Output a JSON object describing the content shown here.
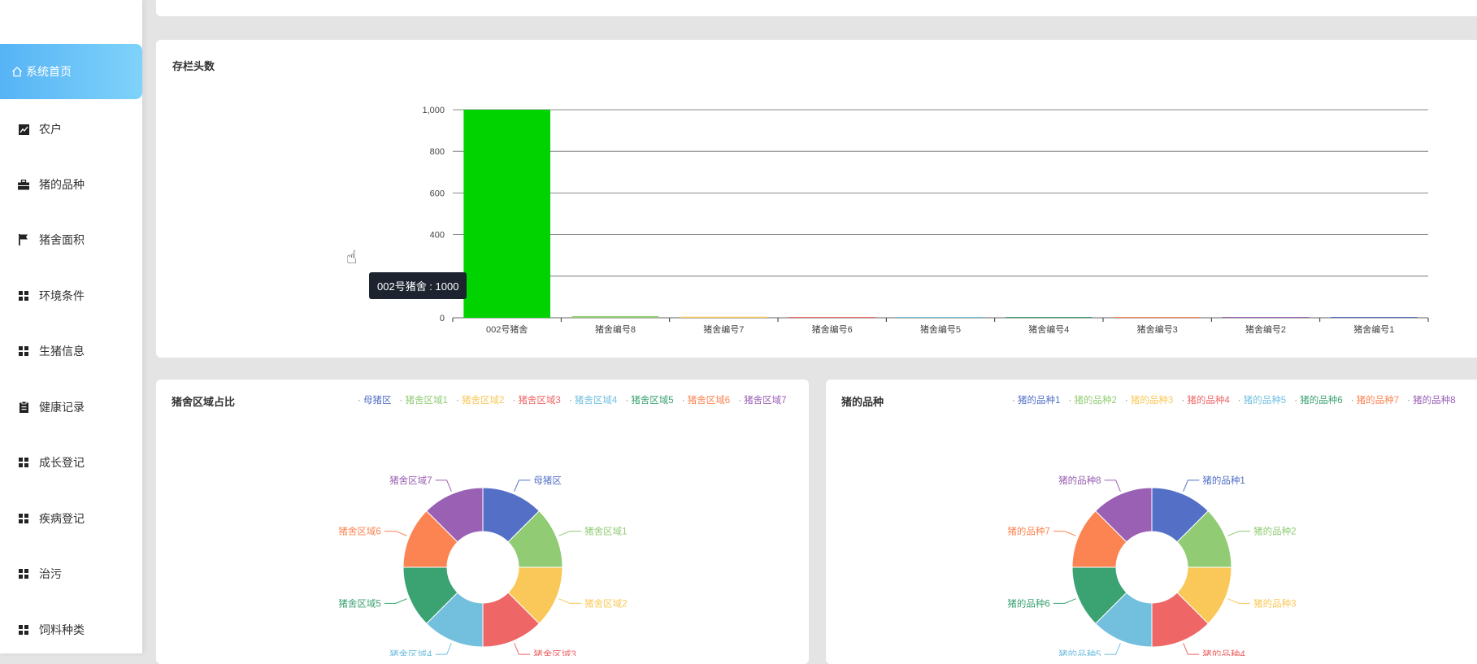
{
  "sidebar": {
    "items": [
      {
        "label": "系统首页",
        "icon": "home-icon",
        "active": true
      },
      {
        "label": "农户",
        "icon": "chart-line-icon"
      },
      {
        "label": "猪的品种",
        "icon": "briefcase-icon"
      },
      {
        "label": "猪舍面积",
        "icon": "flag-icon"
      },
      {
        "label": "环境条件",
        "icon": "grid-icon"
      },
      {
        "label": "生猪信息",
        "icon": "grid-icon"
      },
      {
        "label": "健康记录",
        "icon": "clipboard-icon"
      },
      {
        "label": "成长登记",
        "icon": "grid-icon"
      },
      {
        "label": "疾病登记",
        "icon": "grid-icon"
      },
      {
        "label": "治污",
        "icon": "grid-icon"
      },
      {
        "label": "饲料种类",
        "icon": "grid-icon"
      }
    ]
  },
  "colors": {
    "bar": "#00d300",
    "palette": [
      "#5470c6",
      "#91cc75",
      "#fac858",
      "#ee6666",
      "#73c0de",
      "#3ba272",
      "#fc8452",
      "#9a60b4"
    ]
  },
  "bar_card": {
    "title": "存栏头数"
  },
  "tooltip": {
    "text": "002号猪舍 : 1000"
  },
  "pie1_card": {
    "title": "猪舍区域占比"
  },
  "pie2_card": {
    "title": "猪的品种"
  },
  "chart_data": [
    {
      "type": "bar",
      "categories": [
        "002号猪舍",
        "猪舍编号8",
        "猪舍编号7",
        "猪舍编号6",
        "猪舍编号5",
        "猪舍编号4",
        "猪舍编号3",
        "猪舍编号2",
        "猪舍编号1"
      ],
      "values": [
        1000,
        8,
        5,
        4,
        3,
        3,
        2,
        2,
        1
      ],
      "ylim": [
        0,
        1000
      ],
      "yticks": [
        "0",
        "200",
        "400",
        "600",
        "800",
        "1,000"
      ],
      "grid": true
    },
    {
      "type": "pie",
      "labels": [
        "母猪区",
        "猪舍区域1",
        "猪舍区域2",
        "猪舍区域3",
        "猪舍区域4",
        "猪舍区域5",
        "猪舍区域6",
        "猪舍区域7"
      ],
      "values": [
        1,
        1,
        1,
        1,
        1,
        1,
        1,
        1
      ],
      "legend": "top-right"
    },
    {
      "type": "pie",
      "labels": [
        "猪的品种1",
        "猪的品种2",
        "猪的品种3",
        "猪的品种4",
        "猪的品种5",
        "猪的品种6",
        "猪的品种7",
        "猪的品种8"
      ],
      "values": [
        1,
        1,
        1,
        1,
        1,
        1,
        1,
        1
      ],
      "legend": "top-right"
    }
  ]
}
